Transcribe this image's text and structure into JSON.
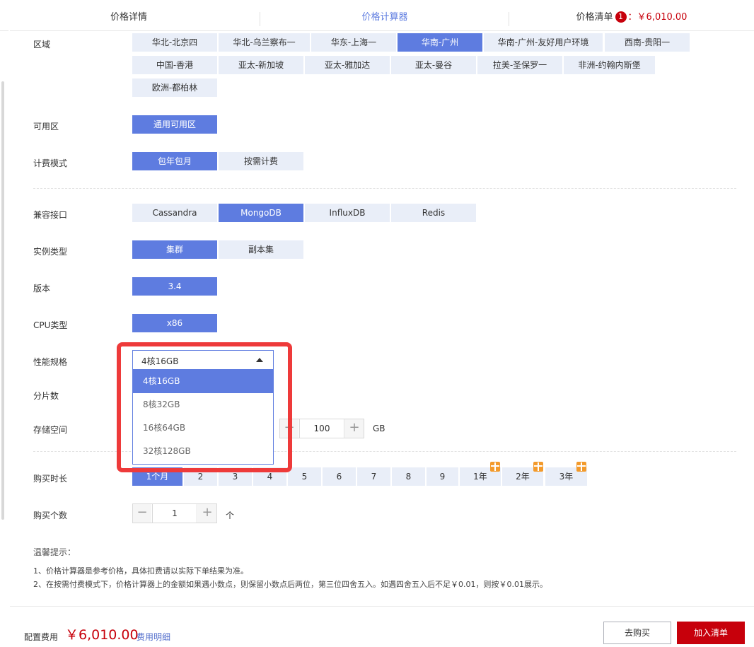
{
  "tabs": {
    "price_details": "价格详情",
    "price_calculator": "价格计算器",
    "price_list": "价格清单",
    "cart_count": "1",
    "cart_price": "：￥6,010.00"
  },
  "region": {
    "label": "区域",
    "options": [
      "华北-北京四",
      "华北-乌兰察布一",
      "华东-上海一",
      "华南-广州",
      "华南-广州-友好用户环境",
      "西南-贵阳一",
      "中国-香港",
      "亚太-新加坡",
      "亚太-雅加达",
      "亚太-曼谷",
      "拉美-圣保罗一",
      "非洲-约翰内斯堡",
      "欧洲-都柏林"
    ],
    "selected": "华南-广州"
  },
  "az": {
    "label": "可用区",
    "options": [
      "通用可用区"
    ]
  },
  "billing": {
    "label": "计费模式",
    "options": [
      "包年包月",
      "按需计费"
    ]
  },
  "engine": {
    "label": "兼容接口",
    "options": [
      "Cassandra",
      "MongoDB",
      "InfluxDB",
      "Redis"
    ]
  },
  "instance_type": {
    "label": "实例类型",
    "options": [
      "集群",
      "副本集"
    ]
  },
  "version": {
    "label": "版本",
    "options": [
      "3.4"
    ]
  },
  "cpu": {
    "label": "CPU类型",
    "options": [
      "x86"
    ]
  },
  "spec": {
    "label": "性能规格",
    "selected": "4核16GB",
    "options": [
      "4核16GB",
      "8核32GB",
      "16核64GB",
      "32核128GB"
    ]
  },
  "shards": {
    "label": "分片数"
  },
  "storage": {
    "label": "存储空间",
    "value": "100",
    "unit": "GB"
  },
  "duration": {
    "label": "购买时长",
    "options": [
      "1个月",
      "2",
      "3",
      "4",
      "5",
      "6",
      "7",
      "8",
      "9",
      "1年",
      "2年",
      "3年"
    ],
    "selected": "1个月"
  },
  "quantity": {
    "label": "购买个数",
    "value": "1",
    "unit": "个"
  },
  "tips": {
    "title": "温馨提示：",
    "line1": "1、价格计算器是参考价格，具体扣费请以实际下单结果为准。",
    "line2": "2、在按需付费模式下，价格计算器上的金额如果遇小数点，则保留小数点后两位，第三位四舍五入。如遇四舍五入后不足￥0.01，则按￥0.01展示。"
  },
  "footer": {
    "fee_label": "配置费用",
    "fee_value": "￥6,010.00",
    "fee_detail_link": "费用明细",
    "buy_button": "去购买",
    "add_button": "加入清单"
  },
  "colors": {
    "primary": "#5e7ce0",
    "option_bg": "#e9eef8",
    "brand_red": "#c7000b",
    "highlight_frame": "#ee3a3a",
    "gift": "#f39a2b"
  }
}
